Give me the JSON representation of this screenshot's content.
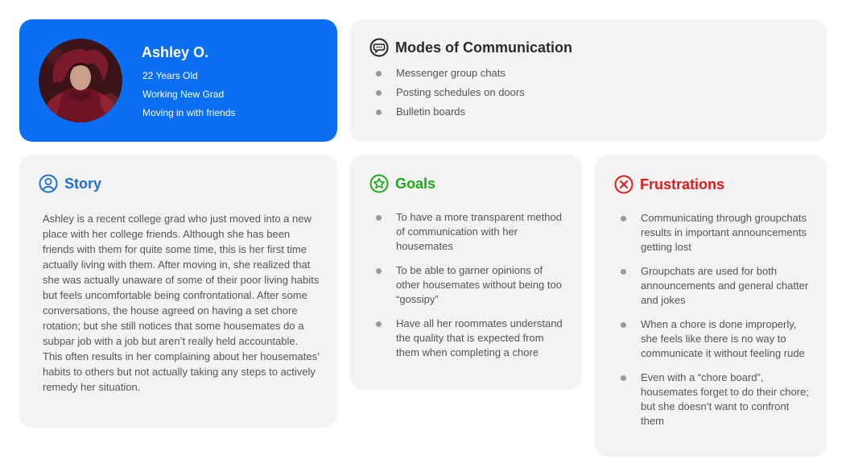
{
  "profile": {
    "name": "Ashley O.",
    "details": [
      "22 Years Old",
      "Working New Grad",
      "Moving in with friends"
    ]
  },
  "modes": {
    "title": "Modes of Communication",
    "icon": "chat-bubble-icon",
    "items": [
      "Messenger group chats",
      "Posting schedules on doors",
      "Bulletin boards"
    ]
  },
  "story": {
    "title": "Story",
    "icon": "user-circle-icon",
    "text": "Ashley is a recent college grad who just moved into a new place with her college friends.  Although she has been friends with them for quite some time, this is her first time actually living with them.  After moving in, she realized that she was actually unaware of some of their poor living habits but feels uncomfortable being confrontational.  After some conversations, the house agreed on having a set chore rotation; but she still notices that some housemates do a subpar job with a job but aren’t really held accountable.  This often results in her complaining about her housemates’ habits to others but not actually taking any steps to actively remedy her situation."
  },
  "goals": {
    "title": "Goals",
    "icon": "star-circle-icon",
    "items": [
      "To have a more transparent method of communication with her housemates",
      "To be able to garner opinions of other housemates without being too “gossipy”",
      "Have all her roommates understand the quality that is expected from them when completing a chore"
    ]
  },
  "frustrations": {
    "title": "Frustrations",
    "icon": "x-circle-icon",
    "items": [
      "Communicating through groupchats results in important announcements getting lost",
      "Groupchats are used for both announcements and general chatter and jokes",
      "When a chore is done improperly, she feels like there is no way to communicate it without feeling rude",
      "Even with a “chore board”, housemates forget to do their chore; but she doesn’t want to confront them"
    ]
  },
  "colors": {
    "profile_bg": "#0a6ff2",
    "card_bg": "#f3f3f3",
    "story_accent": "#1f6fd6",
    "goals_accent": "#1faa1f",
    "frustrations_accent": "#e01b1b",
    "modes_accent": "#222222"
  }
}
